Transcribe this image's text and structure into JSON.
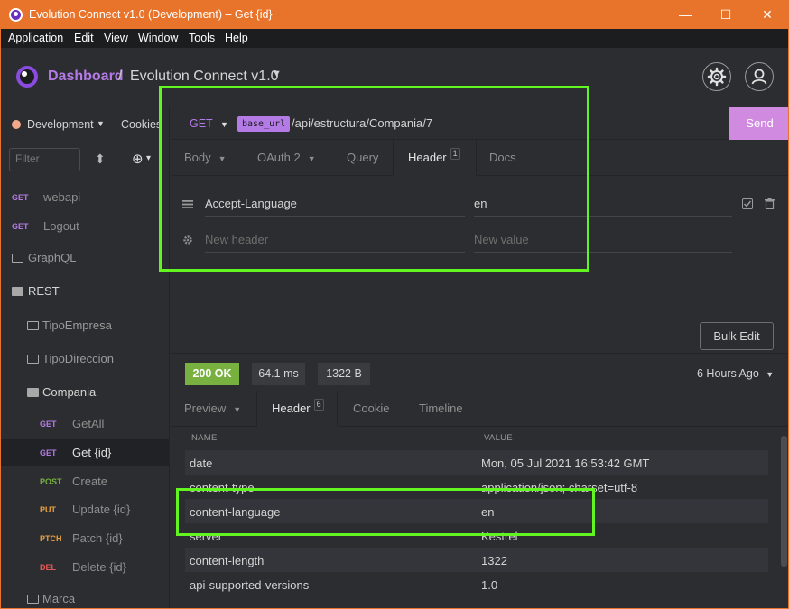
{
  "window": {
    "title": "Evolution Connect v1.0 (Development) – Get {id}",
    "minimize_glyph": "—",
    "maximize_glyph": "☐",
    "close_glyph": "✕"
  },
  "menu": [
    "Application",
    "Edit",
    "View",
    "Window",
    "Tools",
    "Help"
  ],
  "header": {
    "dashboard_label": "Dashboard",
    "separator": "/",
    "project_label": "Evolution Connect v1.0",
    "caret": "▼"
  },
  "sidebar": {
    "environment": "Development",
    "env_caret": "▼",
    "cookies_label": "Cookies",
    "filter_placeholder": "Filter",
    "sort_glyph": "⬍",
    "add_glyph": "⊕",
    "add_caret": "▾",
    "items": [
      {
        "method": "GET",
        "label": "webapi"
      },
      {
        "method": "GET",
        "label": "Logout"
      }
    ],
    "graphql_folder": "GraphQL",
    "rest_folder": "REST",
    "tipo_empresa": "TipoEmpresa",
    "tipo_direccion": "TipoDireccion",
    "compania_folder": "Compania",
    "compania_requests": [
      {
        "method": "GET",
        "label": "GetAll"
      },
      {
        "method": "GET",
        "label": "Get {id}"
      },
      {
        "method": "POST",
        "label": "Create"
      },
      {
        "method": "PUT",
        "label": "Update {id}"
      },
      {
        "method": "PTCH",
        "label": "Patch {id}"
      },
      {
        "method": "DEL",
        "label": "Delete {id}"
      }
    ],
    "marca_folder": "Marca"
  },
  "request": {
    "method": "GET",
    "method_caret": "▼",
    "base_url_tag": "base_url",
    "path": "/api/estructura/Compania/7",
    "send_label": "Send",
    "tabs": {
      "body": "Body",
      "oauth": "OAuth 2",
      "query": "Query",
      "header": "Header",
      "header_badge": "1",
      "docs": "Docs"
    },
    "header_row": {
      "name": "Accept-Language",
      "value": "en"
    },
    "new_header_placeholder": "New header",
    "new_value_placeholder": "New value",
    "bulk_edit_label": "Bulk Edit"
  },
  "response": {
    "status": "200 OK",
    "time": "64.1 ms",
    "size": "1322 B",
    "time_ago": "6 Hours Ago",
    "time_ago_caret": "▼",
    "tabs": {
      "preview": "Preview",
      "header": "Header",
      "header_badge": "6",
      "cookie": "Cookie",
      "timeline": "Timeline"
    },
    "columns": [
      "NAME",
      "VALUE"
    ],
    "headers": [
      {
        "name": "date",
        "value": "Mon, 05 Jul 2021 16:53:42 GMT"
      },
      {
        "name": "content-type",
        "value": "application/json; charset=utf-8"
      },
      {
        "name": "content-language",
        "value": "en"
      },
      {
        "name": "server",
        "value": "Kestrel"
      },
      {
        "name": "content-length",
        "value": "1322"
      },
      {
        "name": "api-supported-versions",
        "value": "1.0"
      }
    ]
  },
  "colors": {
    "titlebar": "#e8742c",
    "accent_purple": "#b47be6",
    "send_button": "#d08ae0",
    "status_ok": "#78b13f",
    "highlight": "#63f51f",
    "method_get": "#b47be6",
    "method_post": "#78b13f",
    "method_put": "#e8a13c",
    "method_patch": "#e8a13c",
    "method_del": "#e85858"
  }
}
